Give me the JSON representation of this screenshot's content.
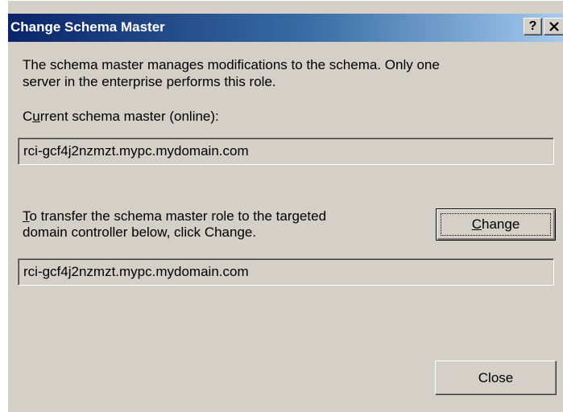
{
  "dialog": {
    "title": "Change Schema Master",
    "help_button": "?",
    "close_icon": "close-icon",
    "description_line1": "The schema master manages modifications to the schema. Only one",
    "description_line2": "server in the enterprise performs this role.",
    "current_label_mnemonic": "u",
    "current_label_prefix": "C",
    "current_label_rest": "rrent schema master (online):",
    "current_master_value": "rci-gcf4j2nzmzt.mypc.mydomain.com",
    "transfer_mnemonic": "T",
    "transfer_line1_rest": "o transfer the schema master role to the targeted",
    "transfer_line2": "domain controller below, click Change.",
    "change_button_mnemonic": "C",
    "change_button_rest": "hange",
    "target_dc_value": "rci-gcf4j2nzmzt.mypc.mydomain.com",
    "close_button": "Close"
  },
  "colors": {
    "titlebar_start": "#0a246a",
    "titlebar_end": "#a6caf0",
    "dialog_face": "#d4d0c8"
  }
}
